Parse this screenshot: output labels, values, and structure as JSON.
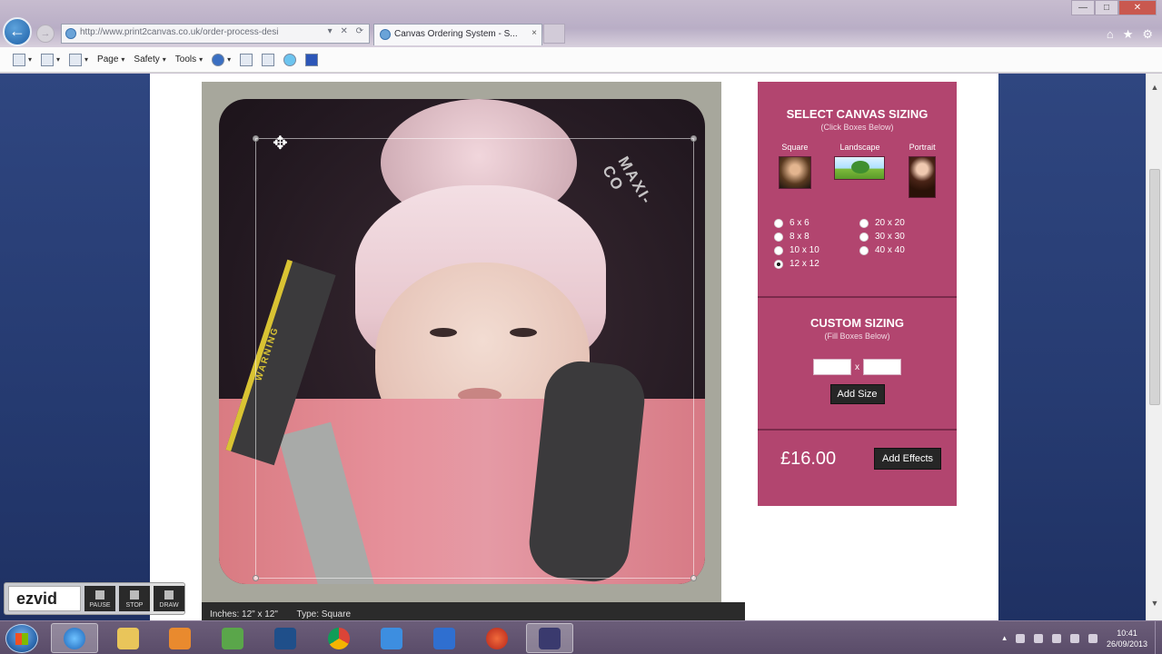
{
  "browser": {
    "address_url": "http://www.print2canvas.co.uk/order-process-desi",
    "tab_title": "Canvas Ordering System - S...",
    "tab_close": "×",
    "window_controls": [
      "—",
      "□",
      "✕"
    ],
    "ie_icons": [
      "home-icon",
      "favorites-icon",
      "tools-gear-icon"
    ]
  },
  "command_bar": {
    "page_label": "Page",
    "safety_label": "Safety",
    "tools_label": "Tools"
  },
  "editor": {
    "brand_text": "MAXI-CO",
    "warning_text": "WARNING",
    "info_inches": "Inches: 12\" x 12\"",
    "info_type": "Type: Square"
  },
  "panel": {
    "select_title": "SELECT CANVAS SIZING",
    "select_sub": "(Click Boxes Below)",
    "shapes": [
      {
        "label": "Square",
        "icon": "square-thumbnail"
      },
      {
        "label": "Landscape",
        "icon": "landscape-thumbnail"
      },
      {
        "label": "Portrait",
        "icon": "portrait-thumbnail"
      }
    ],
    "sizes": [
      "6 x 6",
      "20 x 20",
      "8 x 8",
      "30 x 30",
      "10 x 10",
      "40 x 40",
      "12 x 12"
    ],
    "selected_size": "12 x 12",
    "custom_title": "CUSTOM SIZING",
    "custom_sub": "(Fill Boxes Below)",
    "custom_separator": "x",
    "custom_width": "",
    "custom_height": "",
    "add_size_label": "Add Size",
    "price": "£16.00",
    "add_effects_label": "Add Effects"
  },
  "ezvid": {
    "logo": "ezvid",
    "buttons": [
      "PAUSE",
      "STOP",
      "DRAW"
    ]
  },
  "taskbar": {
    "apps": [
      "internet-explorer-icon",
      "file-explorer-icon",
      "media-player-icon",
      "people-icon",
      "photoshop-icon",
      "chrome-icon",
      "dropbox-icon",
      "app-icon",
      "ccleaner-icon",
      "video-editor-icon"
    ],
    "clock_time": "10:41",
    "clock_date": "26/09/2013"
  },
  "colors": {
    "panel": "#b2456f",
    "panel_border": "#7b2a4b",
    "side_bg": "#2f4680",
    "button_dark": "#262626"
  }
}
